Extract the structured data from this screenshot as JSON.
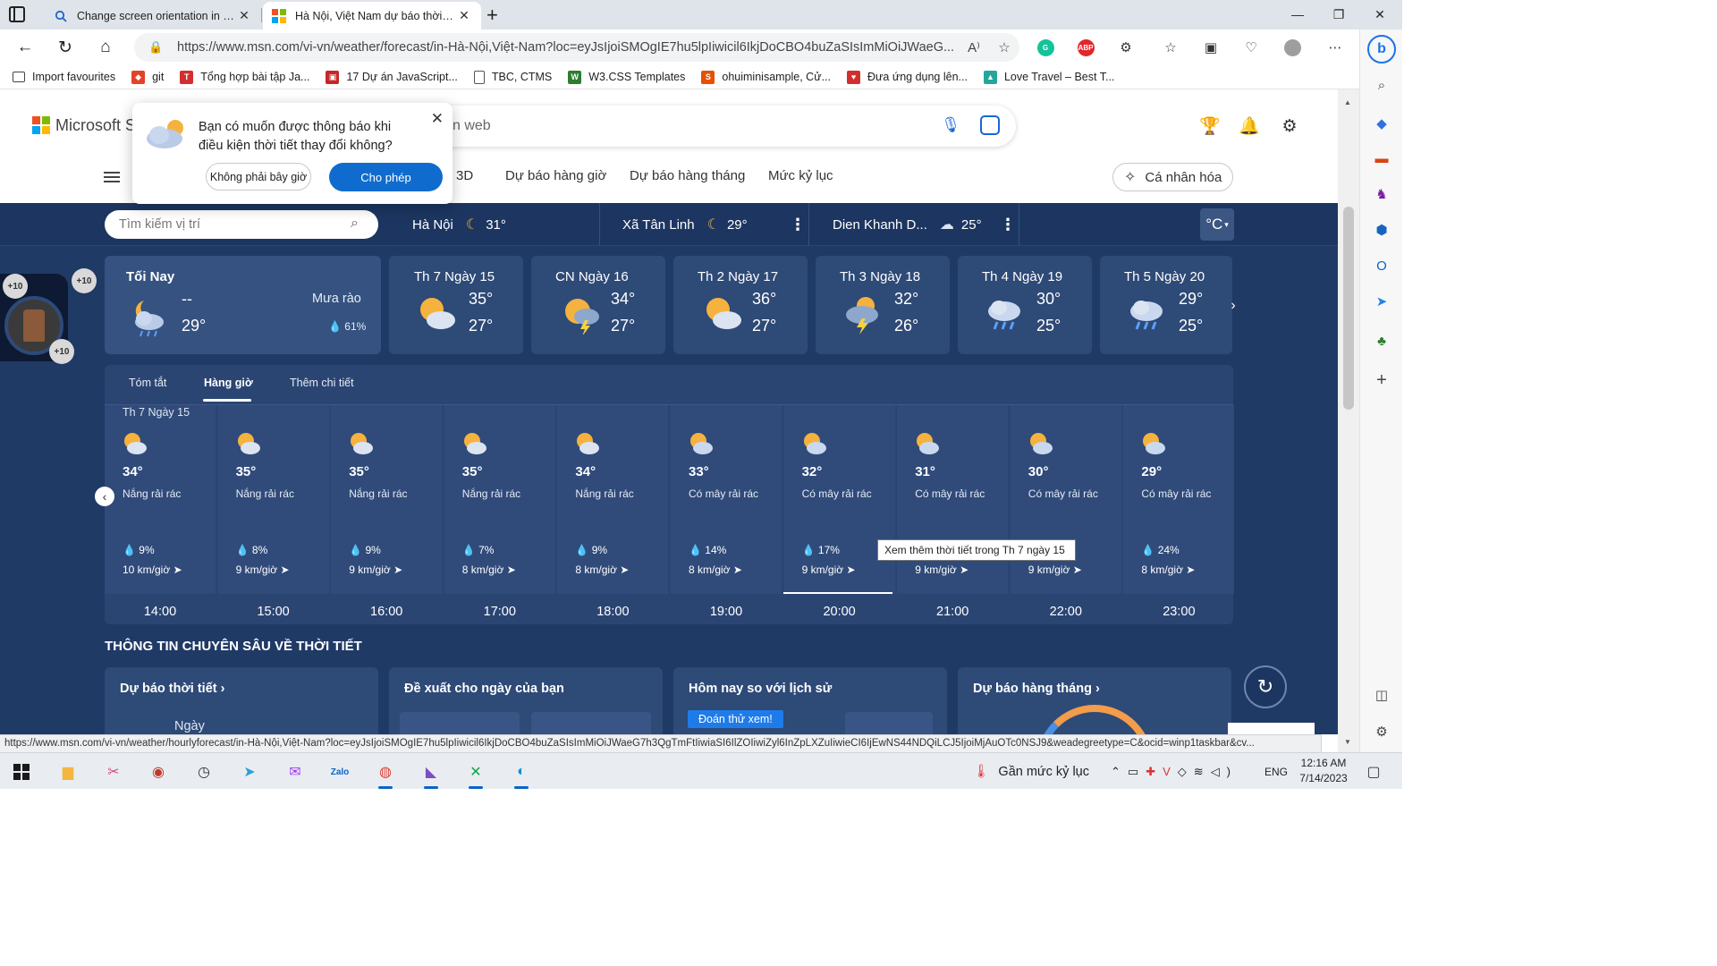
{
  "browser": {
    "tabs": [
      {
        "title": "Change screen orientation in Wir",
        "icon": "search-icon"
      },
      {
        "title": "Hà Nội, Việt Nam dự báo thời tiế",
        "icon": "msn-icon"
      }
    ],
    "url": "https://www.msn.com/vi-vn/weather/forecast/in-Hà-Nội,Việt-Nam?loc=eyJsIjoiSMOgIE7hu5lpIiwicil6IkjDoCBO4buZaSIsImMiOiJWaeG...",
    "bookmarks": [
      {
        "label": "Import favourites",
        "color": "#444444"
      },
      {
        "label": "git",
        "color": "#e24329"
      },
      {
        "label": "Tổng hợp bài tập Ja...",
        "color": "#d32f2f"
      },
      {
        "label": "17 Dự án JavaScript...",
        "color": "#c62828"
      },
      {
        "label": "TBC, CTMS",
        "color": "#555555"
      },
      {
        "label": "W3.CSS Templates",
        "color": "#2e7d32"
      },
      {
        "label": "ohuiminisample, Cử...",
        "color": "#e65100"
      },
      {
        "label": "Đưa ứng dụng lên...",
        "color": "#d32f2f"
      },
      {
        "label": "Love Travel – Best T...",
        "color": "#26a69a"
      }
    ]
  },
  "msn": {
    "brand": "Microsoft St",
    "search_placeholder": "n web",
    "nav": [
      "3D",
      "Dự báo hàng giờ",
      "Dự báo hàng tháng",
      "Mức kỷ lục"
    ],
    "personalize": "Cá nhân hóa"
  },
  "notification": {
    "message": "Bạn có muốn được thông báo khi điều kiện thời tiết thay đổi không?",
    "later": "Không phải bây giờ",
    "allow": "Cho phép"
  },
  "weather_bar": {
    "search_placeholder": "Tìm kiếm vị trí",
    "cities": [
      {
        "name": "Hà Nội",
        "temp": "31°",
        "icon": "moon-icon"
      },
      {
        "name": "Xã Tân Linh",
        "temp": "29°",
        "icon": "moon-icon"
      },
      {
        "name": "Dien Khanh D...",
        "temp": "25°",
        "icon": "cloud-sun-icon"
      }
    ],
    "unit": "°C"
  },
  "badge": {
    "top_left": "+10",
    "top_right": "+10",
    "bottom": "+10"
  },
  "today": {
    "label": "Tối Nay",
    "high": "--",
    "low": "29°",
    "condition": "Mưa rào",
    "precip": "61%"
  },
  "days": [
    {
      "label": "Th 7 Ngày 15",
      "high": "35°",
      "low": "27°",
      "icon": "partly-sunny-icon"
    },
    {
      "label": "CN Ngày 16",
      "high": "34°",
      "low": "27°",
      "icon": "thunder-sun-icon"
    },
    {
      "label": "Th 2 Ngày 17",
      "high": "36°",
      "low": "27°",
      "icon": "partly-sunny-icon"
    },
    {
      "label": "Th 3 Ngày 18",
      "high": "32°",
      "low": "26°",
      "icon": "thunderstorm-icon"
    },
    {
      "label": "Th 4 Ngày 19",
      "high": "30°",
      "low": "25°",
      "icon": "rain-cloud-icon"
    },
    {
      "label": "Th 5 Ngày 20",
      "high": "29°",
      "low": "25°",
      "icon": "rain-cloud-icon"
    }
  ],
  "hourly": {
    "tabs": [
      "Tóm tắt",
      "Hàng giờ",
      "Thêm chi tiết"
    ],
    "date": "Th 7 Ngày 15",
    "tooltip": "Xem thêm thời tiết trong Th 7 ngày 15",
    "hours": [
      {
        "time": "14:00",
        "temp": "34°",
        "cond": "Nắng rải rác",
        "precip": "9%",
        "wind": "10 km/giờ"
      },
      {
        "time": "15:00",
        "temp": "35°",
        "cond": "Nắng rải rác",
        "precip": "8%",
        "wind": "9 km/giờ"
      },
      {
        "time": "16:00",
        "temp": "35°",
        "cond": "Nắng rải rác",
        "precip": "9%",
        "wind": "9 km/giờ"
      },
      {
        "time": "17:00",
        "temp": "35°",
        "cond": "Nắng rải rác",
        "precip": "7%",
        "wind": "8 km/giờ"
      },
      {
        "time": "18:00",
        "temp": "34°",
        "cond": "Nắng rải rác",
        "precip": "9%",
        "wind": "8 km/giờ"
      },
      {
        "time": "19:00",
        "temp": "33°",
        "cond": "Có mây rải rác",
        "precip": "14%",
        "wind": "8 km/giờ"
      },
      {
        "time": "20:00",
        "temp": "32°",
        "cond": "Có mây rải rác",
        "precip": "17%",
        "wind": "9 km/giờ"
      },
      {
        "time": "21:00",
        "temp": "31°",
        "cond": "Có mây rải rác",
        "precip": "",
        "wind": "9 km/giờ"
      },
      {
        "time": "22:00",
        "temp": "30°",
        "cond": "Có mây rải rác",
        "precip": "",
        "wind": "9 km/giờ"
      },
      {
        "time": "23:00",
        "temp": "29°",
        "cond": "Có mây rải rác",
        "precip": "24%",
        "wind": "8 km/giờ"
      }
    ]
  },
  "insights": {
    "title": "THÔNG TIN CHUYÊN SÂU VỀ THỜI TIẾT",
    "cards": [
      "Dự báo thời tiết",
      "Đề xuất cho ngày của bạn",
      "Hôm nay so với lịch sử",
      "Dự báo hàng tháng"
    ],
    "day_label": "Ngày",
    "guess_button": "Đoán thử xem!"
  },
  "status_url": "https://www.msn.com/vi-vn/weather/hourlyforecast/in-Hà-Nội,Việt-Nam?loc=eyJsIjoiSMOgIE7hu5lpIiwicil6IkjDoCBO4buZaSIsImMiOiJWaeG7h3QgTmFtIiwiaSI6IlZOIiwiZyl6InZpLXZuIiwieCI6IjEwNS44NDQiLCJ5IjoiMjAuOTc0NSJ9&weadegreetype=C&ocid=winp1taskbar&cv...",
  "taskbar": {
    "weather_text": "Gần mức kỷ lục",
    "language": "ENG",
    "time": "12:16 AM",
    "date": "7/14/2023"
  }
}
